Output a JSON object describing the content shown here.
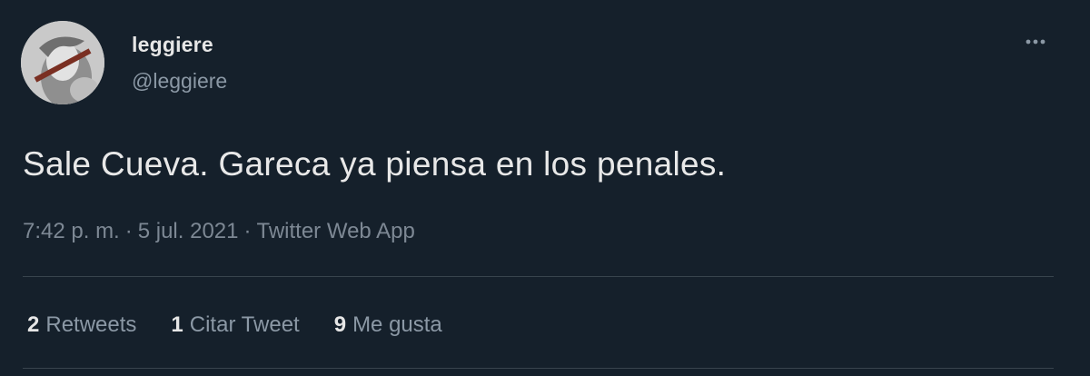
{
  "user": {
    "display_name": "leggiere",
    "handle": "@leggiere"
  },
  "tweet": {
    "text": "Sale Cueva. Gareca ya piensa en los penales.",
    "time": "7:42 p. m.",
    "separator": "·",
    "date": "5 jul. 2021",
    "client": "Twitter Web App"
  },
  "stats": [
    {
      "count": "2",
      "label": "Retweets"
    },
    {
      "count": "1",
      "label": "Citar Tweet"
    },
    {
      "count": "9",
      "label": "Me gusta"
    }
  ],
  "icons": {
    "more": "more-options-icon",
    "avatar": "profile-photo"
  },
  "colors": {
    "background": "#15202b",
    "primary_text": "#e6e6e6",
    "secondary_text": "#8b98a5",
    "divider": "#38444d"
  }
}
